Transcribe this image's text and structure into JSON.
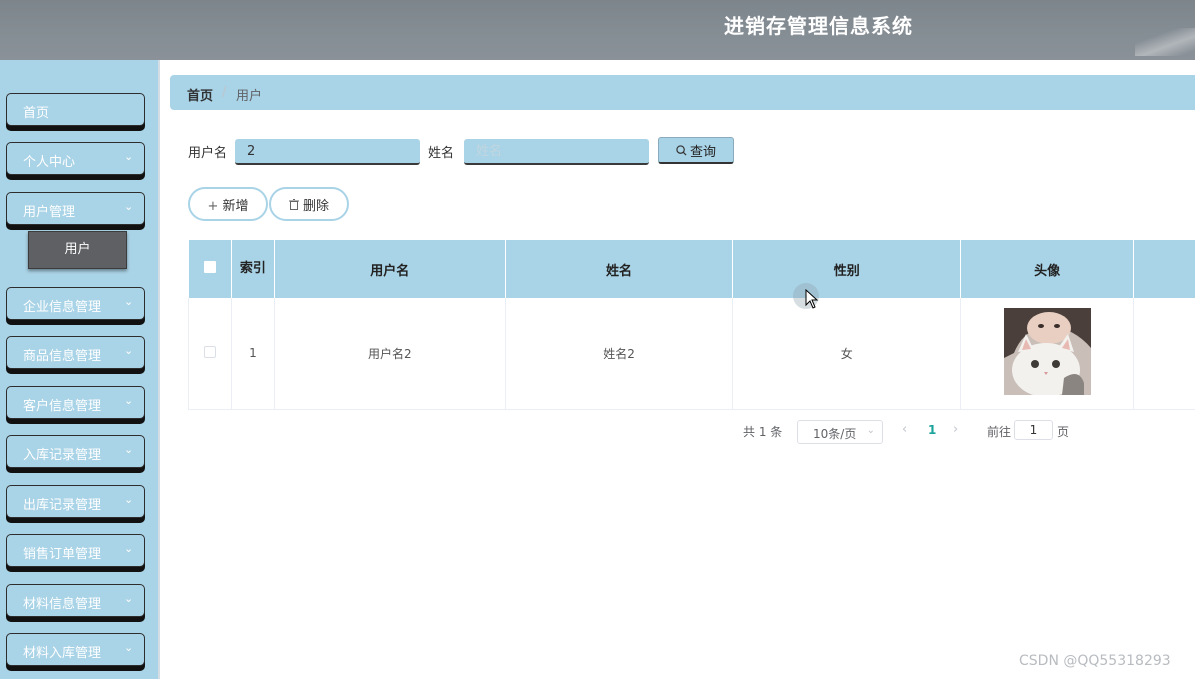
{
  "header": {
    "title": "进销存管理信息系统"
  },
  "sidebar": {
    "items": [
      {
        "label": "首页",
        "has_chevron": false
      },
      {
        "label": "个人中心",
        "has_chevron": true
      },
      {
        "label": "用户管理",
        "has_chevron": true
      },
      {
        "label": "企业信息管理",
        "has_chevron": true
      },
      {
        "label": "商品信息管理",
        "has_chevron": true
      },
      {
        "label": "客户信息管理",
        "has_chevron": true
      },
      {
        "label": "入库记录管理",
        "has_chevron": true
      },
      {
        "label": "出库记录管理",
        "has_chevron": true
      },
      {
        "label": "销售订单管理",
        "has_chevron": true
      },
      {
        "label": "材料信息管理",
        "has_chevron": true
      },
      {
        "label": "材料入库管理",
        "has_chevron": true
      }
    ],
    "active_sub_item": "用户"
  },
  "breadcrumb": {
    "home": "首页",
    "separator": "/",
    "current": "用户"
  },
  "search": {
    "username_label": "用户名",
    "username_value": "2",
    "name_label": "姓名",
    "name_placeholder": "姓名",
    "query_button": "查询",
    "search_icon": "search-icon"
  },
  "actions": {
    "add_label": "新增",
    "delete_label": "删除",
    "add_icon": "plus-icon",
    "delete_icon": "trash-icon"
  },
  "table": {
    "headers": [
      "索引",
      "用户名",
      "姓名",
      "性别",
      "头像"
    ],
    "rows": [
      {
        "index": "1",
        "username": "用户名2",
        "name": "姓名2",
        "gender": "女",
        "avatar": "avatar-photo-girl-with-cat"
      }
    ]
  },
  "pagination": {
    "total_text": "共 1 条",
    "page_size": "10条/页",
    "current_page": "1",
    "goto_label": "前往",
    "goto_value": "1",
    "page_suffix": "页"
  },
  "watermark": "CSDN @QQ55318293",
  "colors": {
    "accent": "#a9d3e6",
    "header": "#838a91",
    "sub_active": "#5e6063",
    "page_active": "#1aa39a"
  }
}
